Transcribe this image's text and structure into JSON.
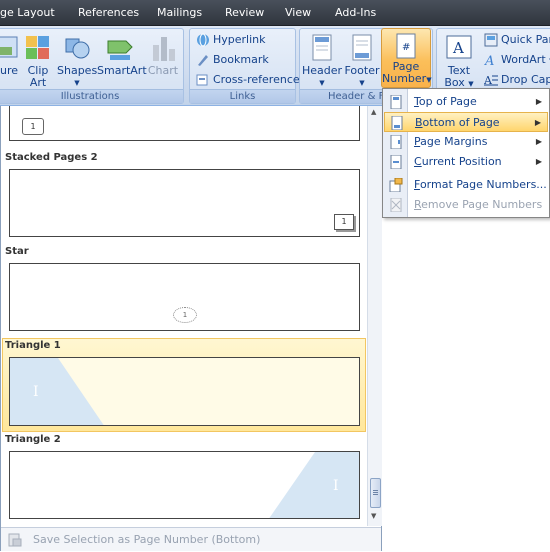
{
  "tabs": [
    "ge Layout",
    "References",
    "Mailings",
    "Review",
    "View",
    "Add-Ins"
  ],
  "ribbon": {
    "illustrations": {
      "label": "Illustrations",
      "picture_partial": "ure",
      "clip_art": [
        "Clip",
        "Art"
      ],
      "shapes": "Shapes",
      "smartart": "SmartArt",
      "chart": "Chart"
    },
    "links": {
      "label": "Links",
      "hyperlink": "Hyperlink",
      "bookmark": "Bookmark",
      "cross_reference": "Cross-reference"
    },
    "header_footer": {
      "label": "Header & F",
      "header": "Header",
      "footer": "Footer",
      "page_number": [
        "Page",
        "Number"
      ]
    },
    "text": {
      "text_box": [
        "Text",
        "Box"
      ],
      "quick_parts": "Quick Part",
      "wordart": "WordArt",
      "drop_cap": "Drop Cap"
    }
  },
  "gallery": {
    "entries": [
      {
        "title": "Stacked Pages 2"
      },
      {
        "title": "Star"
      },
      {
        "title": "Triangle 1"
      },
      {
        "title": "Triangle 2"
      }
    ],
    "thumb_number": "1",
    "triangle_number": "I",
    "footer_action": "Save Selection as Page Number (Bottom)"
  },
  "menu": {
    "items": [
      {
        "label_u": "T",
        "label_rest": "op of Page",
        "has_submenu": true
      },
      {
        "label_u": "B",
        "label_rest": "ottom of Page",
        "has_submenu": true
      },
      {
        "label_u": "P",
        "label_rest": "age Margins",
        "has_submenu": true
      },
      {
        "label_u": "C",
        "label_rest": "urrent Position",
        "has_submenu": true
      },
      {
        "label_u": "F",
        "label_rest": "ormat Page Numbers...",
        "has_submenu": false
      },
      {
        "label_u": "R",
        "label_rest": "emove Page Numbers",
        "has_submenu": false
      }
    ],
    "active_index": 1
  },
  "colors": {
    "accent_orange": "#fbbf5a",
    "ribbon_blue": "#dfe8f5",
    "triangle_blue": "#cfe3f3"
  }
}
